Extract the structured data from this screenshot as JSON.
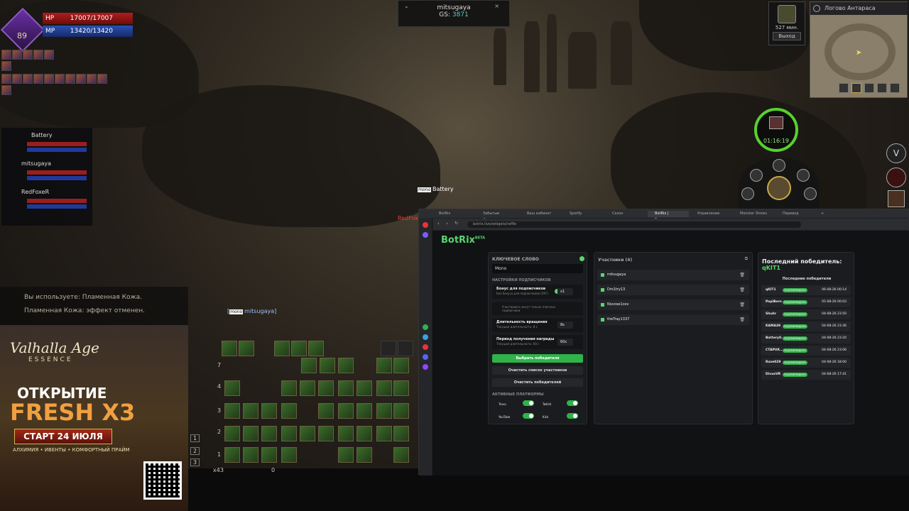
{
  "player": {
    "level": "89",
    "hp_label": "HP",
    "hp_value": "17007/17007",
    "mp_label": "MP",
    "mp_value": "13420/13420"
  },
  "party": [
    {
      "name": "Battery"
    },
    {
      "name": "mitsugaya"
    },
    {
      "name": "RedFoxeR"
    }
  ],
  "target": {
    "name": "mitsugaya",
    "gs_label": "GS:",
    "gs_value": "3871"
  },
  "minimap": {
    "location": "Логово Антараса",
    "time_left": "527 мин.",
    "exit_label": "Выход"
  },
  "timer": {
    "value": "01:16:19"
  },
  "chat": [
    "Вы используете: Пламенная Кожа.",
    "Пламенная Кожа: эффект отменен."
  ],
  "ad": {
    "logo": "Valhalla Age",
    "logo_sub": "ESSENCE",
    "open": "ОТКРЫТИЕ",
    "fresh": "FRESH X3",
    "start": "СТАРТ 24 ИЮЛЯ",
    "tagline": "АЛХИМИЯ • ИВЕНТЫ • КОМФОРТНЫЙ ПРАЙМ"
  },
  "world_names": {
    "battery": "Battery",
    "redfox": "RedFox",
    "self": "mitsugaya",
    "badge": "mono"
  },
  "hotbar": {
    "rows": [
      "7",
      "4",
      "3",
      "2",
      "1"
    ],
    "pages": [
      "1",
      "2",
      "3"
    ],
    "count": "x43",
    "count2": "0"
  },
  "browser": {
    "url": "botrix.live/widgets/raffle",
    "tabs": [
      "BotRix",
      "Забытые Измерения",
      "Ваш кабинет",
      "Spotify",
      "Сезон",
      "BotRix | Розыгрыш",
      "Управление",
      "Monster Shows",
      "Перевод"
    ]
  },
  "botrix": {
    "brand": "BotRix",
    "brand_tag": "BETA",
    "keyword_label": "КЛЮЧЕВОЕ СЛОВО",
    "keyword_value": "Mono",
    "subs_section": "НАСТРОЙКИ ПОДПИСЧИКОВ",
    "sub_bonus_label": "Бонус для подписчиков",
    "sub_bonus_hint": "Без бонуса для подписчиков (OFF)",
    "sub_bonus_value": "x1",
    "sub_only": "Участвовать могут только платные подписчики",
    "spin_label": "Длительность вращения",
    "spin_hint": "Текущая длительность: 8 с",
    "spin_value": "8s",
    "claim_label": "Период получения награды",
    "claim_hint": "Текущая длительность: 60 с",
    "claim_value": "60s",
    "pick_winner": "Выбрать победителя",
    "clear_participants": "Очистить список участников",
    "clear_winners": "Очистить победителей",
    "platforms_title": "АКТИВНЫЕ ПЛАТФОРМЫ",
    "platforms": [
      "Trovo",
      "Twitch",
      "YouTube",
      "Kick"
    ],
    "participants_title": "Участники (4)",
    "participants": [
      "mitsugaya",
      "Dm1try13",
      "Novose1cev",
      "theTray1337"
    ],
    "last_winner_label": "Последний победитель:",
    "last_winner": "qKIT1",
    "winners_title": "Последние победители",
    "confirmed": "ПОДТВЕРЖДЕНО",
    "winners": [
      {
        "name": "qKIT1",
        "date": "06-08-26 00:14"
      },
      {
        "name": "PapiBern",
        "date": "05-08-26 00:03"
      },
      {
        "name": "Shuhr",
        "date": "04-08-26 23:50"
      },
      {
        "name": "KAMA39",
        "date": "04-08-26 23:36"
      },
      {
        "name": "Battery0...",
        "date": "04-08-26 23:20"
      },
      {
        "name": "CTAPUK...",
        "date": "04-08-26 23:06"
      },
      {
        "name": "Raze029",
        "date": "04-08-26 18:00"
      },
      {
        "name": "DivusVR",
        "date": "04-08-26 17:41"
      }
    ]
  },
  "colors": {
    "accent": "#59d66f",
    "hp": "#b01d1d",
    "mp": "#2a4fb0",
    "timer": "#57d12e"
  }
}
